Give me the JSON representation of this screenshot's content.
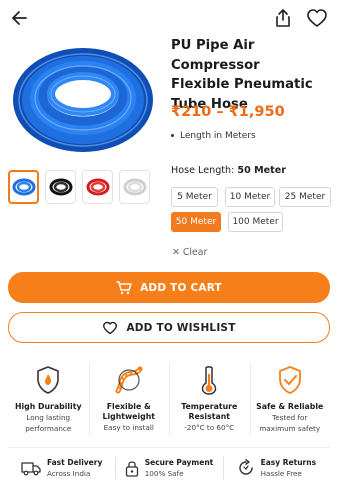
{
  "product": {
    "title_lines": [
      "PU Pipe Air Compressor",
      "Flexible Pneumatic",
      "Tube Hose"
    ],
    "price_range": "₹210 – ₹1,950",
    "bullet": "Length in Meters",
    "image_icon": "blue-coiled-hose-image",
    "thumbnails": [
      "blue-hose-thumb",
      "black-hose-thumb",
      "red-hose-thumb",
      "clear-hose-thumb"
    ]
  },
  "hose_length": {
    "label": "Hose Length:",
    "selected": "50 Meter",
    "options": [
      "5 Meter",
      "10 Meter",
      "25 Meter",
      "50 Meter",
      "100 Meter"
    ],
    "clear": "Clear"
  },
  "actions": {
    "add_to_cart": "ADD TO CART",
    "add_to_wishlist": "ADD TO WISHLIST"
  },
  "features": [
    {
      "icon": "durability-shield-icon",
      "title": "High Durability",
      "sub": [
        "Long lasting",
        "performance"
      ]
    },
    {
      "icon": "flexible-hose-icon",
      "title": "Flexible &",
      "title2": "Lightweight",
      "sub": [
        "Easy to install"
      ]
    },
    {
      "icon": "thermometer-icon",
      "title": "Temperature",
      "title2": "Resistant",
      "sub": [
        "-20°C to 60°C"
      ]
    },
    {
      "icon": "safe-shield-check-icon",
      "title": "Safe & Reliable",
      "sub": [
        "Tested for",
        "maximum safety"
      ]
    }
  ],
  "benefits": [
    {
      "icon": "delivery-truck-icon",
      "title": "Fast Delivery",
      "sub": "Across India"
    },
    {
      "icon": "lock-icon",
      "title": "Secure Payment",
      "sub": "100% Safe"
    },
    {
      "icon": "return-icon",
      "title": "Easy Returns",
      "sub": "Hassle Free"
    }
  ],
  "colors": {
    "accent": "#f77f1a",
    "price": "#ef6a12",
    "hose_blue": "#1f6fe0"
  }
}
